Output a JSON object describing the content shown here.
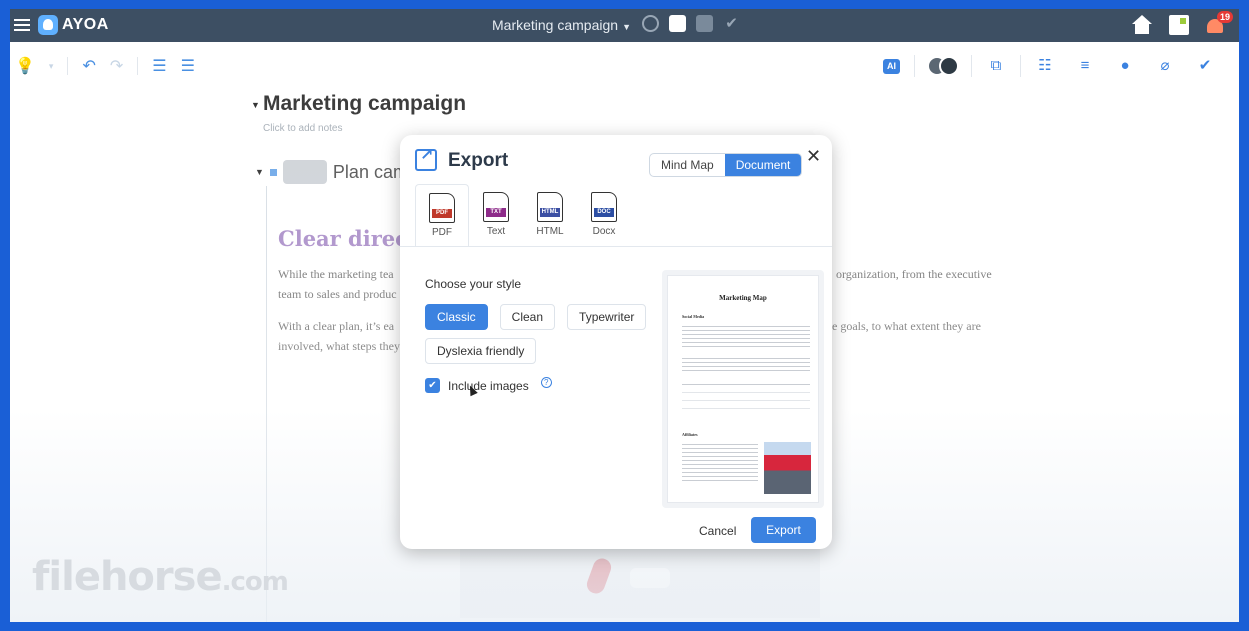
{
  "app": {
    "logo_text": "AYOA",
    "doc_title_top": "Marketing campaign",
    "notification_count": "19"
  },
  "document": {
    "title": "Marketing campaign",
    "add_notes": "Click to add notes",
    "plan_item": "Plan camp",
    "heading": "Clear directi",
    "para1_line1": "While the marketing tea",
    "para1_line2": "team to sales and produc",
    "para1_right": "organization, from the executive",
    "para2_line1": "With a clear plan, it’s ea",
    "para2_line2": "involved, what steps they",
    "para2_right": "e goals, to what extent they are"
  },
  "dialog": {
    "title": "Export",
    "toggle": [
      "Mind Map",
      "Document"
    ],
    "toggle_active": "Document",
    "formats": [
      {
        "label": "PDF",
        "tag": "PDF",
        "icon": "pdf-file-icon"
      },
      {
        "label": "Text",
        "tag": "TXT",
        "icon": "txt-file-icon"
      },
      {
        "label": "HTML",
        "tag": "HTML",
        "icon": "html-file-icon"
      },
      {
        "label": "Docx",
        "tag": "DOC",
        "icon": "docx-file-icon"
      }
    ],
    "selected_format": "PDF",
    "style_label": "Choose your style",
    "styles": [
      "Classic",
      "Clean",
      "Typewriter",
      "Dyslexia friendly"
    ],
    "selected_style": "Classic",
    "include_images_label": "Include images",
    "include_images_checked": true,
    "help_glyph": "?",
    "preview": {
      "title": "Marketing Map",
      "section1": "Social Media",
      "section2": "Affiliates"
    },
    "cancel_label": "Cancel",
    "export_label": "Export"
  },
  "watermark": {
    "main": "filehorse",
    "suffix": ".com"
  },
  "colors": {
    "accent": "#3b82e0",
    "topbar": "#3d4f63",
    "heading_purple": "#a88bc7"
  }
}
